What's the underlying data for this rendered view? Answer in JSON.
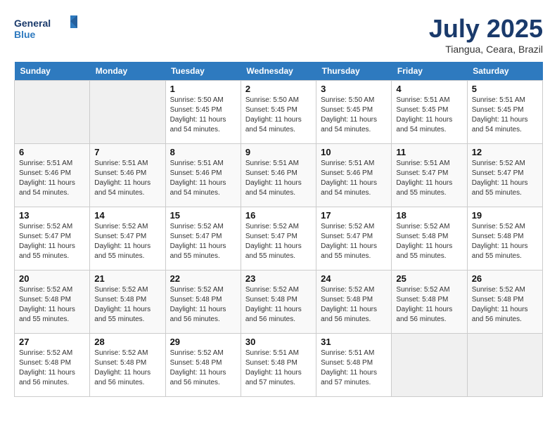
{
  "header": {
    "logo_general": "General",
    "logo_blue": "Blue",
    "month_year": "July 2025",
    "location": "Tiangua, Ceara, Brazil"
  },
  "weekdays": [
    "Sunday",
    "Monday",
    "Tuesday",
    "Wednesday",
    "Thursday",
    "Friday",
    "Saturday"
  ],
  "weeks": [
    [
      {
        "day": "",
        "info": ""
      },
      {
        "day": "",
        "info": ""
      },
      {
        "day": "1",
        "info": "Sunrise: 5:50 AM\nSunset: 5:45 PM\nDaylight: 11 hours and 54 minutes."
      },
      {
        "day": "2",
        "info": "Sunrise: 5:50 AM\nSunset: 5:45 PM\nDaylight: 11 hours and 54 minutes."
      },
      {
        "day": "3",
        "info": "Sunrise: 5:50 AM\nSunset: 5:45 PM\nDaylight: 11 hours and 54 minutes."
      },
      {
        "day": "4",
        "info": "Sunrise: 5:51 AM\nSunset: 5:45 PM\nDaylight: 11 hours and 54 minutes."
      },
      {
        "day": "5",
        "info": "Sunrise: 5:51 AM\nSunset: 5:45 PM\nDaylight: 11 hours and 54 minutes."
      }
    ],
    [
      {
        "day": "6",
        "info": "Sunrise: 5:51 AM\nSunset: 5:46 PM\nDaylight: 11 hours and 54 minutes."
      },
      {
        "day": "7",
        "info": "Sunrise: 5:51 AM\nSunset: 5:46 PM\nDaylight: 11 hours and 54 minutes."
      },
      {
        "day": "8",
        "info": "Sunrise: 5:51 AM\nSunset: 5:46 PM\nDaylight: 11 hours and 54 minutes."
      },
      {
        "day": "9",
        "info": "Sunrise: 5:51 AM\nSunset: 5:46 PM\nDaylight: 11 hours and 54 minutes."
      },
      {
        "day": "10",
        "info": "Sunrise: 5:51 AM\nSunset: 5:46 PM\nDaylight: 11 hours and 54 minutes."
      },
      {
        "day": "11",
        "info": "Sunrise: 5:51 AM\nSunset: 5:47 PM\nDaylight: 11 hours and 55 minutes."
      },
      {
        "day": "12",
        "info": "Sunrise: 5:52 AM\nSunset: 5:47 PM\nDaylight: 11 hours and 55 minutes."
      }
    ],
    [
      {
        "day": "13",
        "info": "Sunrise: 5:52 AM\nSunset: 5:47 PM\nDaylight: 11 hours and 55 minutes."
      },
      {
        "day": "14",
        "info": "Sunrise: 5:52 AM\nSunset: 5:47 PM\nDaylight: 11 hours and 55 minutes."
      },
      {
        "day": "15",
        "info": "Sunrise: 5:52 AM\nSunset: 5:47 PM\nDaylight: 11 hours and 55 minutes."
      },
      {
        "day": "16",
        "info": "Sunrise: 5:52 AM\nSunset: 5:47 PM\nDaylight: 11 hours and 55 minutes."
      },
      {
        "day": "17",
        "info": "Sunrise: 5:52 AM\nSunset: 5:47 PM\nDaylight: 11 hours and 55 minutes."
      },
      {
        "day": "18",
        "info": "Sunrise: 5:52 AM\nSunset: 5:48 PM\nDaylight: 11 hours and 55 minutes."
      },
      {
        "day": "19",
        "info": "Sunrise: 5:52 AM\nSunset: 5:48 PM\nDaylight: 11 hours and 55 minutes."
      }
    ],
    [
      {
        "day": "20",
        "info": "Sunrise: 5:52 AM\nSunset: 5:48 PM\nDaylight: 11 hours and 55 minutes."
      },
      {
        "day": "21",
        "info": "Sunrise: 5:52 AM\nSunset: 5:48 PM\nDaylight: 11 hours and 55 minutes."
      },
      {
        "day": "22",
        "info": "Sunrise: 5:52 AM\nSunset: 5:48 PM\nDaylight: 11 hours and 56 minutes."
      },
      {
        "day": "23",
        "info": "Sunrise: 5:52 AM\nSunset: 5:48 PM\nDaylight: 11 hours and 56 minutes."
      },
      {
        "day": "24",
        "info": "Sunrise: 5:52 AM\nSunset: 5:48 PM\nDaylight: 11 hours and 56 minutes."
      },
      {
        "day": "25",
        "info": "Sunrise: 5:52 AM\nSunset: 5:48 PM\nDaylight: 11 hours and 56 minutes."
      },
      {
        "day": "26",
        "info": "Sunrise: 5:52 AM\nSunset: 5:48 PM\nDaylight: 11 hours and 56 minutes."
      }
    ],
    [
      {
        "day": "27",
        "info": "Sunrise: 5:52 AM\nSunset: 5:48 PM\nDaylight: 11 hours and 56 minutes."
      },
      {
        "day": "28",
        "info": "Sunrise: 5:52 AM\nSunset: 5:48 PM\nDaylight: 11 hours and 56 minutes."
      },
      {
        "day": "29",
        "info": "Sunrise: 5:52 AM\nSunset: 5:48 PM\nDaylight: 11 hours and 56 minutes."
      },
      {
        "day": "30",
        "info": "Sunrise: 5:51 AM\nSunset: 5:48 PM\nDaylight: 11 hours and 57 minutes."
      },
      {
        "day": "31",
        "info": "Sunrise: 5:51 AM\nSunset: 5:48 PM\nDaylight: 11 hours and 57 minutes."
      },
      {
        "day": "",
        "info": ""
      },
      {
        "day": "",
        "info": ""
      }
    ]
  ]
}
